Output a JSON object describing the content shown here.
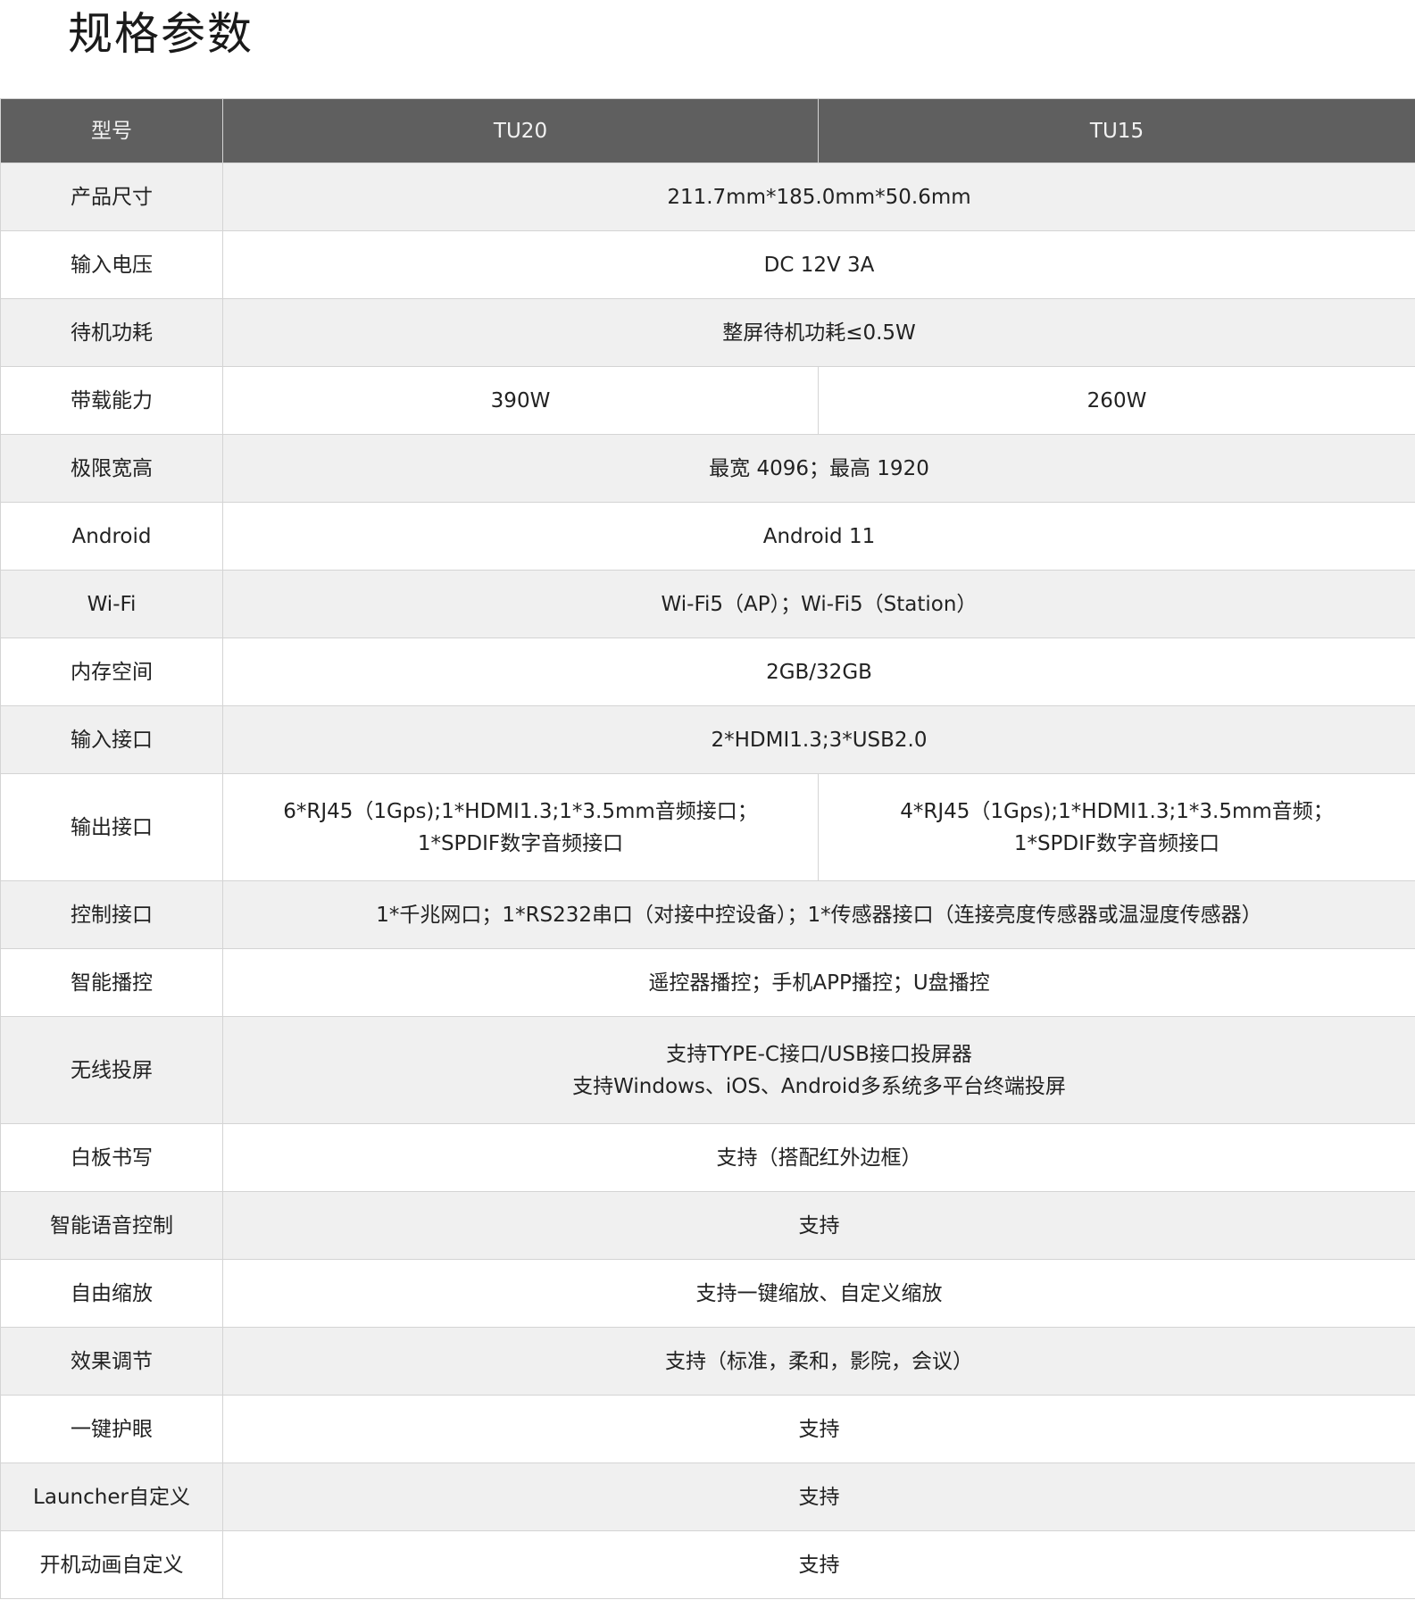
{
  "page": {
    "title": "规格参数"
  },
  "table": {
    "header": {
      "label": "型号",
      "models": [
        "TU20",
        "TU15"
      ]
    },
    "rows": [
      {
        "label": "产品尺寸",
        "value": "211.7mm*185.0mm*50.6mm"
      },
      {
        "label": "输入电压",
        "value": "DC 12V 3A"
      },
      {
        "label": "待机功耗",
        "value": "整屏待机功耗≤0.5W"
      },
      {
        "label": "带载能力",
        "tu20": "390W",
        "tu15": "260W"
      },
      {
        "label": "极限宽高",
        "value": "最宽 4096；最高 1920"
      },
      {
        "label": "Android",
        "value": "Android 11"
      },
      {
        "label": "Wi-Fi",
        "value": "Wi-Fi5（AP）；Wi-Fi5（Station）"
      },
      {
        "label": "内存空间",
        "value": "2GB/32GB"
      },
      {
        "label": "输入接口",
        "value": "2*HDMI1.3;3*USB2.0"
      },
      {
        "label": "输出接口",
        "tu20_lines": [
          "6*RJ45（1Gps);1*HDMI1.3;1*3.5mm音频接口；",
          "1*SPDIF数字音频接口"
        ],
        "tu15_lines": [
          "4*RJ45（1Gps);1*HDMI1.3;1*3.5mm音频；",
          "1*SPDIF数字音频接口"
        ]
      },
      {
        "label": "控制接口",
        "value": "1*千兆网口；1*RS232串口（对接中控设备）；1*传感器接口（连接亮度传感器或温湿度传感器）"
      },
      {
        "label": "智能播控",
        "value": "遥控器播控；手机APP播控；U盘播控"
      },
      {
        "label": "无线投屏",
        "lines": [
          "支持TYPE-C接口/USB接口投屏器",
          "支持Windows、iOS、Android多系统多平台终端投屏"
        ]
      },
      {
        "label": "白板书写",
        "value": "支持（搭配红外边框）"
      },
      {
        "label": "智能语音控制",
        "value": "支持"
      },
      {
        "label": "自由缩放",
        "value": "支持一键缩放、自定义缩放"
      },
      {
        "label": "效果调节",
        "value": "支持（标准，柔和，影院，会议）"
      },
      {
        "label": "一键护眼",
        "value": "支持"
      },
      {
        "label": "Launcher自定义",
        "value": "支持"
      },
      {
        "label": "开机动画自定义",
        "value": "支持"
      }
    ]
  }
}
